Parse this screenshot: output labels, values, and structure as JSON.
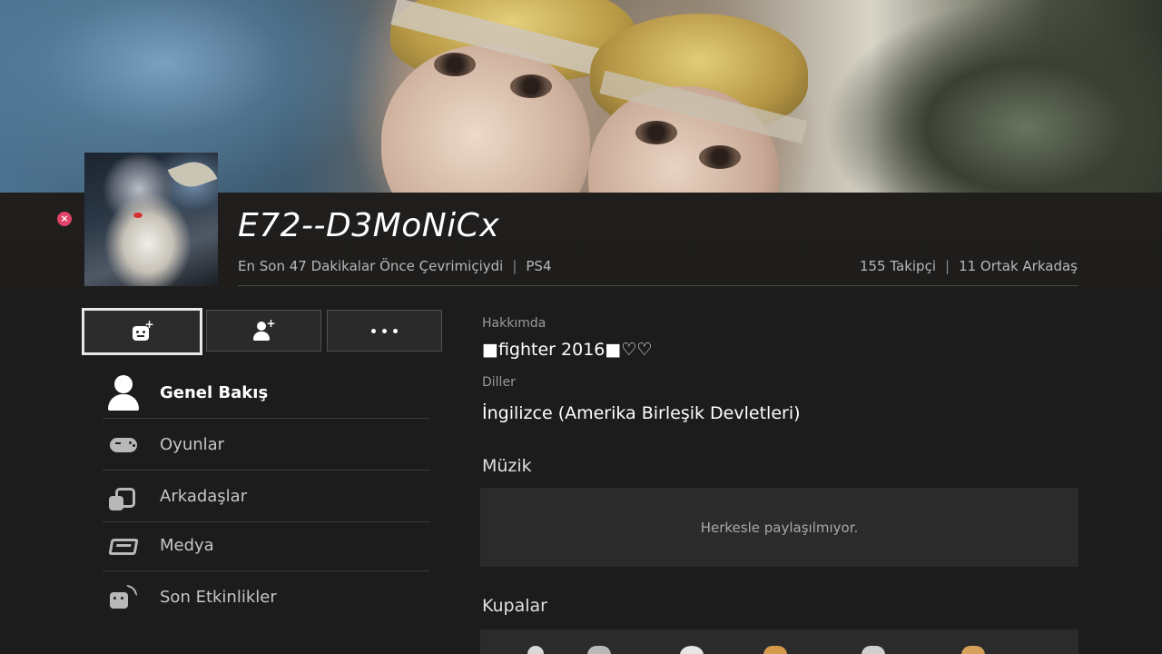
{
  "profile": {
    "username": "E72--D3MoNiCx",
    "last_online": "En Son 47 Dakikalar Önce Çevrimiçiydi",
    "platform": "PS4",
    "followers": "155 Takipçi",
    "mutual_friends": "11 Ortak Arkadaş"
  },
  "actions": [
    {
      "icon": "message-add-icon",
      "selected": true
    },
    {
      "icon": "add-friend-icon",
      "selected": false
    },
    {
      "icon": "more-options-icon",
      "selected": false
    }
  ],
  "nav": {
    "items": [
      {
        "label": "Genel Bakış",
        "icon": "user-icon",
        "active": true
      },
      {
        "label": "Oyunlar",
        "icon": "gamepad-icon",
        "active": false
      },
      {
        "label": "Arkadaşlar",
        "icon": "friends-icon",
        "active": false
      },
      {
        "label": "Medya",
        "icon": "media-icon",
        "active": false
      },
      {
        "label": "Son Etkinlikler",
        "icon": "activity-icon",
        "active": false
      }
    ]
  },
  "about": {
    "heading": "Hakkımda",
    "text": "■fighter 2016■♡♡"
  },
  "languages": {
    "heading": "Diller",
    "value": "İngilizce (Amerika Birleşik Devletleri)"
  },
  "music": {
    "heading": "Müzik",
    "placeholder": "Herkesle paylaşılmıyor."
  },
  "trophies": {
    "heading": "Kupalar"
  },
  "colors": {
    "close_button": "#e0446a",
    "background": "#1c1c1c",
    "panel": "#2b2b2b"
  }
}
